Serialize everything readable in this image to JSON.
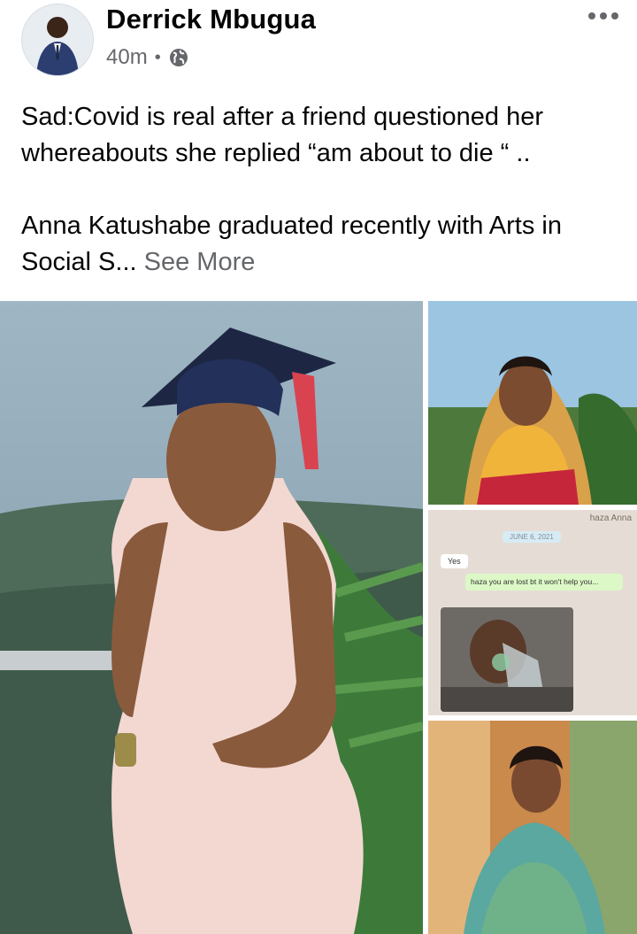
{
  "post": {
    "author": "Derrick Mbugua",
    "time": "40m",
    "separator": "•",
    "audience_icon": "globe-icon",
    "menu_icon": "more-options-icon",
    "text_line1": "Sad:Covid is real after a friend questioned her whereabouts she replied “am about to die “ ..",
    "text_line2": "Anna Katushabe graduated recently with Arts in Social S...",
    "see_more": "See More"
  },
  "chat": {
    "header": "haza Anna",
    "date": "JUNE 6, 2021",
    "incoming": "Yes",
    "outgoing": "haza you are lost bt it won't help you..."
  },
  "colors": {
    "text": "#050505",
    "secondary": "#65676b",
    "chat_bg": "#e5ddd5",
    "chat_out": "#dcf8c6"
  }
}
